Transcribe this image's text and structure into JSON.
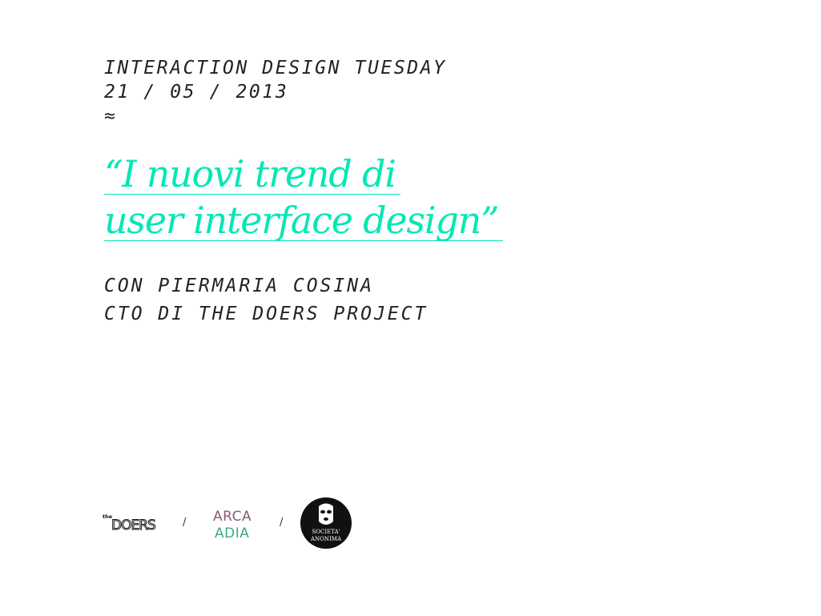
{
  "event": {
    "title": "INTERACTION DESIGN TUESDAY",
    "date": "21 / 05 / 2013",
    "separator": "≈"
  },
  "talk": {
    "title_line1": "“I nuovi trend di",
    "title_line2": "user interface design”"
  },
  "speaker": {
    "line1": "CON PIERMARIA COSINA",
    "line2": "CTO DI THE DOERS PROJECT"
  },
  "logos": {
    "doers": {
      "small": "the",
      "word": "DOERS"
    },
    "arcadia": {
      "line1": "ARCA",
      "line2": "ADIA"
    },
    "societa": {
      "line1": "SOCIETA'",
      "line2": "ANONIMA"
    },
    "separator": "/"
  },
  "colors": {
    "accent": "#00e8b4",
    "text": "#222222",
    "arcadia_top": "#8a5a7a",
    "arcadia_bottom": "#3fa58c",
    "societa_bg": "#111111"
  }
}
